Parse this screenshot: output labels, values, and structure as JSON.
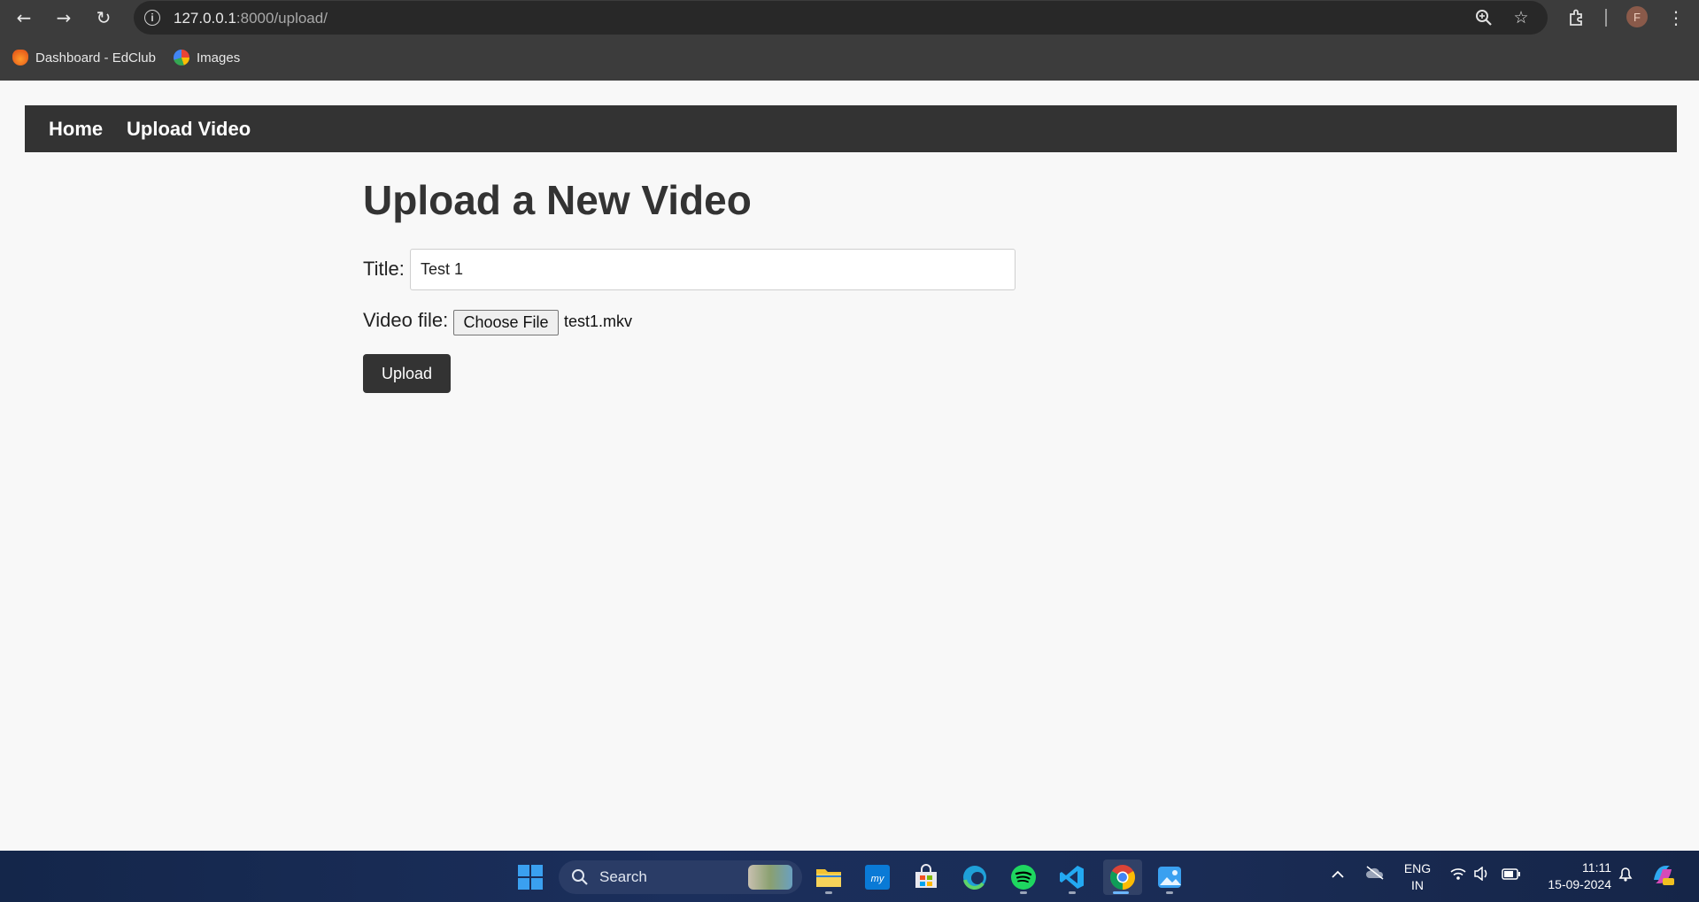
{
  "browser": {
    "url_host": "127.0.0.1",
    "url_path": ":8000/upload/",
    "avatar_letter": "F",
    "bookmarks": [
      {
        "label": "Dashboard - EdClub",
        "icon": "edclub-icon"
      },
      {
        "label": "Images",
        "icon": "google-icon"
      }
    ]
  },
  "navbar": {
    "links": [
      {
        "label": "Home"
      },
      {
        "label": "Upload Video"
      }
    ]
  },
  "form": {
    "heading": "Upload a New Video",
    "title_label": "Title:",
    "title_value": "Test 1",
    "file_label": "Video file:",
    "choose_file_label": "Choose File",
    "file_name": "test1.mkv",
    "submit_label": "Upload"
  },
  "taskbar": {
    "search_label": "Search",
    "lang_line1": "ENG",
    "lang_line2": "IN",
    "time": "11:11",
    "date": "15-09-2024"
  },
  "colors": {
    "navbar_bg": "#333333",
    "page_bg": "#f8f8f8",
    "button_bg": "#333333"
  }
}
